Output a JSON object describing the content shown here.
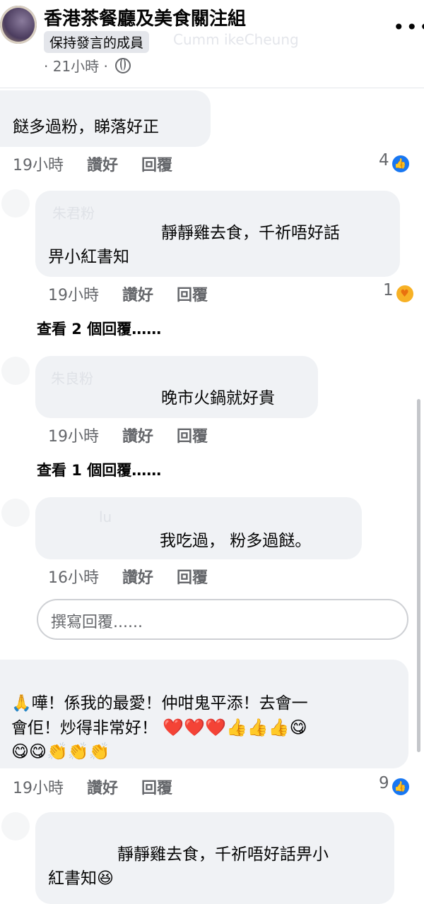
{
  "header": {
    "group_name": "香港茶餐廳及美食關注組",
    "member_badge": "保持發言的成員",
    "author_blurred": "Cumm ikeCheung",
    "time": "· 21小時 ·"
  },
  "comments": [
    {
      "author_blurred": "",
      "text": "餸多過粉，睇落好正",
      "time": "19小時",
      "like_label": "讚好",
      "reply_label": "回覆",
      "reaction_count": "4",
      "reaction_icon": "like-icon"
    },
    {
      "author_blurred": "朱君粉",
      "text_line1": "靜靜雞去食，千祈唔好話",
      "text_line2": "畀小紅書知",
      "time": "19小時",
      "like_label": "讚好",
      "reply_label": "回覆",
      "reaction_count": "1",
      "reaction_icon": "care-icon",
      "view_replies": "查看 2 個回覆……"
    },
    {
      "author_blurred": "朱良粉",
      "text": "晚市火鍋就好貴",
      "time": "19小時",
      "like_label": "讚好",
      "reply_label": "回覆",
      "view_replies": "查看 1 個回覆……"
    },
    {
      "author_blurred": "lu",
      "text": "我吃過，  粉多過餸。",
      "time": "16小時",
      "like_label": "讚好",
      "reply_label": "回覆"
    },
    {
      "author_blurred": "",
      "text_line1": "🙏嘩！係我的最愛！仲咁鬼平添！去會一",
      "text_line2": "會佢！炒得非常好！",
      "emoji_line2": "❤️❤️❤️👍👍👍😋",
      "emoji_line3": "😋😋👏👏👏",
      "time": "19小時",
      "like_label": "讚好",
      "reply_label": "回覆",
      "reaction_count": "9",
      "reaction_icon": "like-icon"
    },
    {
      "author_blurred": "",
      "text_line1": "靜靜雞去食，千祈唔好話畀小",
      "text_line2": "紅書知😆"
    }
  ],
  "reply_input": {
    "placeholder": "撰寫回覆......"
  },
  "icons": {
    "more": "more-options-icon",
    "audience": "globe-icon"
  },
  "colors": {
    "like_blue": "#1877f2",
    "bubble_bg": "#f0f2f5",
    "meta_gray": "#65676b"
  }
}
